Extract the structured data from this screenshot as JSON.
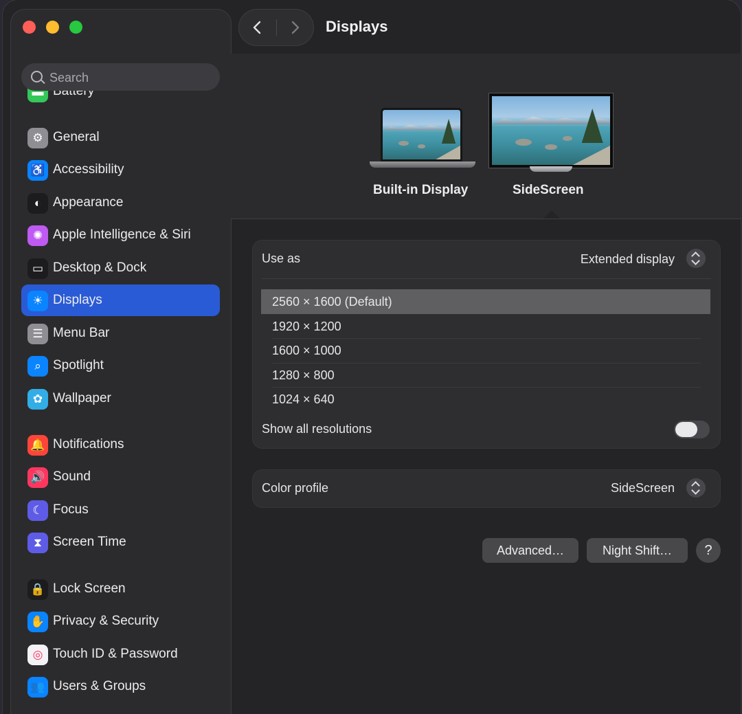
{
  "sidebar": {
    "search_placeholder": "Search",
    "items": [
      {
        "label": "Battery",
        "icon": "battery-icon",
        "color": "#34c759"
      },
      {
        "label": "General",
        "icon": "gear-icon",
        "color": "#8e8e93"
      },
      {
        "label": "Accessibility",
        "icon": "accessibility-icon",
        "color": "#0a84ff"
      },
      {
        "label": "Appearance",
        "icon": "appearance-icon",
        "color": "#1c1c1e"
      },
      {
        "label": "Apple Intelligence & Siri",
        "icon": "siri-icon",
        "color": "#bf5af2"
      },
      {
        "label": "Desktop & Dock",
        "icon": "dock-icon",
        "color": "#1c1c1e"
      },
      {
        "label": "Displays",
        "icon": "sun-icon",
        "color": "#0a84ff",
        "selected": true
      },
      {
        "label": "Menu Bar",
        "icon": "menubar-icon",
        "color": "#8e8e93"
      },
      {
        "label": "Spotlight",
        "icon": "search-icon",
        "color": "#0a84ff"
      },
      {
        "label": "Wallpaper",
        "icon": "flower-icon",
        "color": "#32ade6"
      },
      {
        "label": "Notifications",
        "icon": "bell-icon",
        "color": "#ff453a"
      },
      {
        "label": "Sound",
        "icon": "speaker-icon",
        "color": "#ff375f"
      },
      {
        "label": "Focus",
        "icon": "moon-icon",
        "color": "#5e5ce6"
      },
      {
        "label": "Screen Time",
        "icon": "hourglass-icon",
        "color": "#5e5ce6"
      },
      {
        "label": "Lock Screen",
        "icon": "lock-icon",
        "color": "#1c1c1e"
      },
      {
        "label": "Privacy & Security",
        "icon": "hand-icon",
        "color": "#0a84ff"
      },
      {
        "label": "Touch ID & Password",
        "icon": "fingerprint-icon",
        "color": "#f2f2f7"
      },
      {
        "label": "Users & Groups",
        "icon": "users-icon",
        "color": "#0a84ff"
      }
    ]
  },
  "header": {
    "title": "Displays"
  },
  "displays": {
    "builtin_label": "Built-in Display",
    "external_label": "SideScreen"
  },
  "use_as": {
    "label": "Use as",
    "value": "Extended display"
  },
  "resolutions": [
    {
      "label": "2560 × 1600 (Default)",
      "selected": true
    },
    {
      "label": "1920 × 1200"
    },
    {
      "label": "1600 × 1000"
    },
    {
      "label": "1280 × 800"
    },
    {
      "label": "1024 × 640"
    }
  ],
  "show_all": {
    "label": "Show all resolutions",
    "enabled": false
  },
  "color_profile": {
    "label": "Color profile",
    "value": "SideScreen"
  },
  "buttons": {
    "advanced": "Advanced…",
    "night_shift": "Night Shift…",
    "help": "?"
  }
}
